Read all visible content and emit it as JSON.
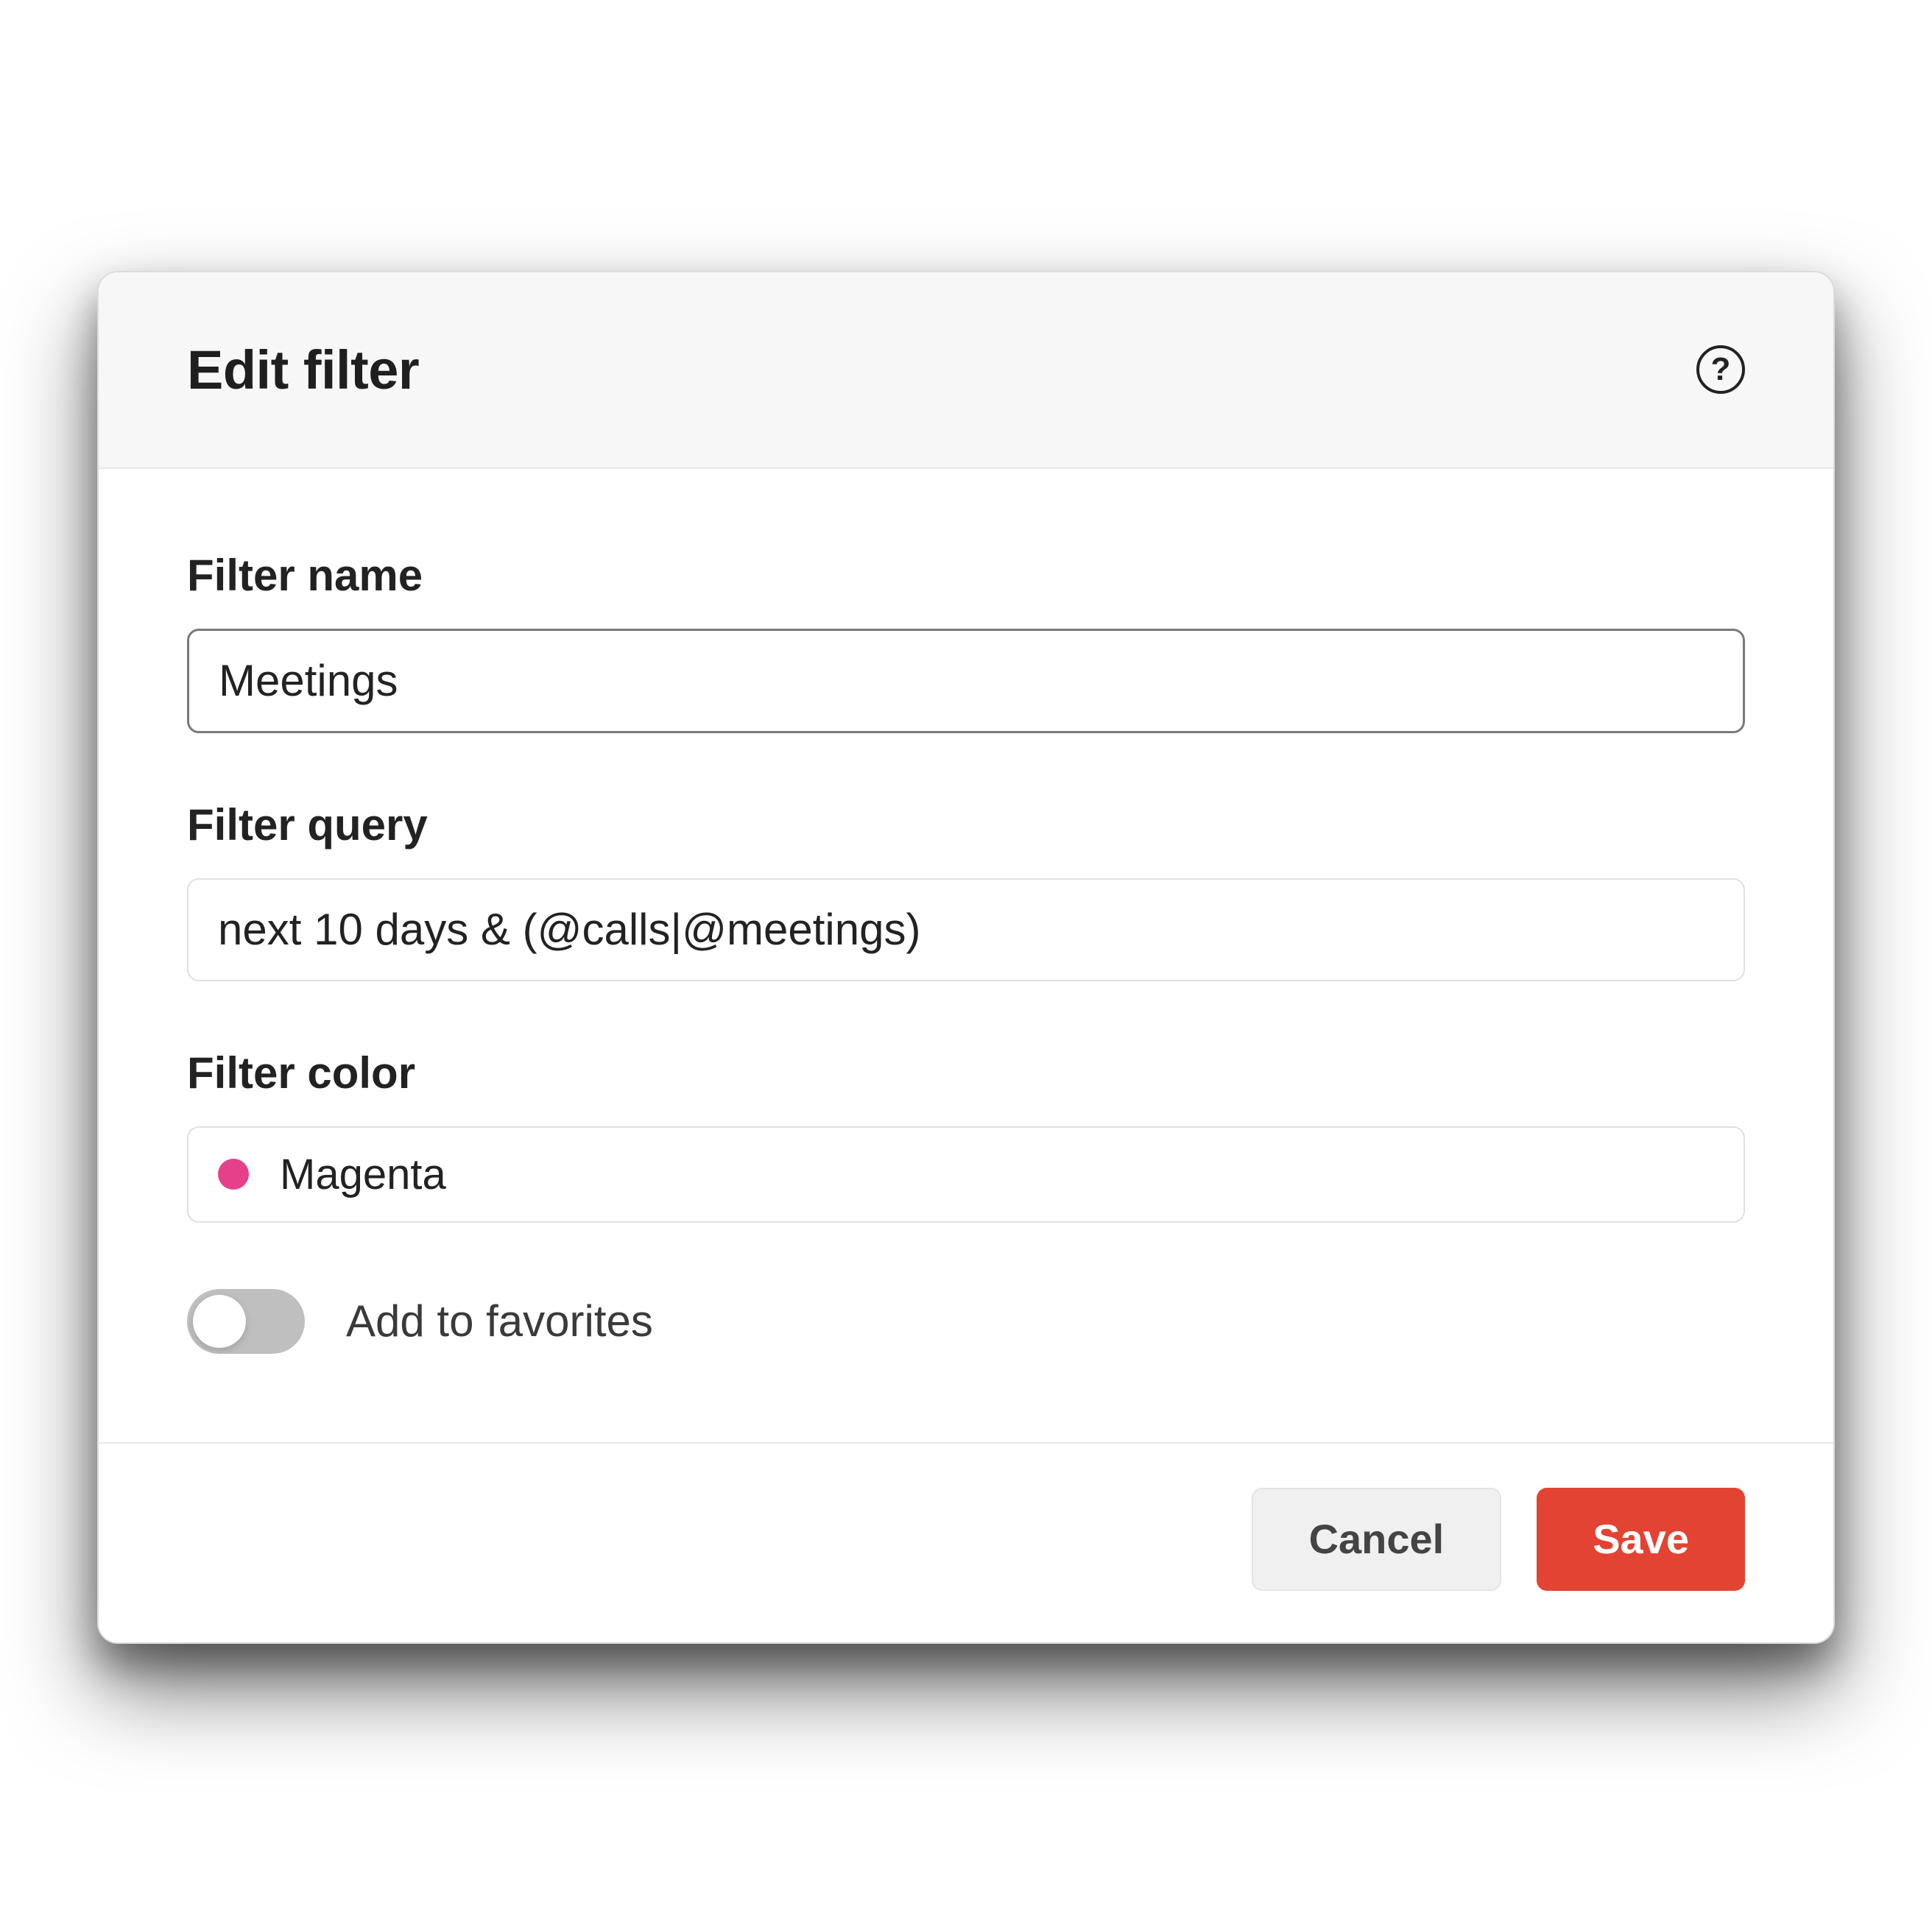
{
  "dialog": {
    "title": "Edit filter",
    "help_icon_label": "?"
  },
  "form": {
    "name": {
      "label": "Filter name",
      "value": "Meetings"
    },
    "query": {
      "label": "Filter query",
      "value": "next 10 days & (@calls|@meetings)"
    },
    "color": {
      "label": "Filter color",
      "selected_name": "Magenta",
      "selected_hex": "#e6408b"
    },
    "favorites": {
      "label": "Add to favorites",
      "on": false
    }
  },
  "footer": {
    "cancel_label": "Cancel",
    "save_label": "Save"
  }
}
